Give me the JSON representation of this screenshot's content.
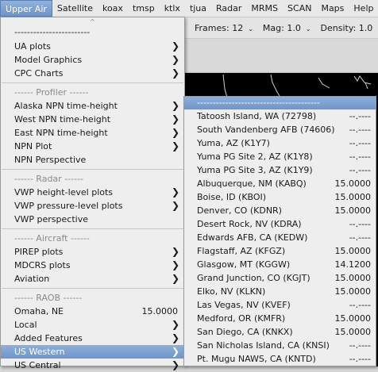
{
  "menubar": [
    "Upper Air",
    "Satellite",
    "koax",
    "tmsp",
    "ktlx",
    "tjua",
    "Radar",
    "MRMS",
    "SCAN",
    "Maps",
    "Help"
  ],
  "toolbar": {
    "frames": "Frames: 12",
    "mag": "Mag: 1.0",
    "density": "Density: 1.0",
    "arrow": "⌄"
  },
  "upper_air_menu": {
    "scroll_up": "^",
    "dashes": "------------------------",
    "ua_plots": "UA plots",
    "model_graphics": "Model Graphics",
    "cpc_charts": "CPC Charts",
    "profiler_header": "------ Profiler ------",
    "alaska_npn": "Alaska NPN time-height",
    "west_npn": "West NPN time-height",
    "east_npn": "East NPN time-height",
    "npn_plot": "NPN Plot",
    "npn_perspective": "NPN Perspective",
    "radar_header": "------ Radar ------",
    "vwp_height": "VWP height-level plots",
    "vwp_pressure": "VWP pressure-level plots",
    "vwp_perspective": "VWP perspective",
    "aircraft_header": "------ Aircraft ------",
    "pirep": "PIREP plots",
    "mdcrs": "MDCRS plots",
    "aviation": "Aviation",
    "raob_header": "------ RAOB ------",
    "omaha": "Omaha, NE",
    "omaha_value": "15.0000",
    "local": "Local",
    "added_features": "Added Features",
    "us_western": "US Western",
    "us_central": "US Central",
    "submenu_arrow": "❯"
  },
  "us_western_menu": {
    "tearoff": "---------------------------------------",
    "stations": [
      {
        "name": "Tatoosh Island, WA (72798)",
        "value": "--.----"
      },
      {
        "name": "South Vandenberg AFB (74606)",
        "value": "--.----"
      },
      {
        "name": "Yuma, AZ (K1Y7)",
        "value": "--.----"
      },
      {
        "name": "Yuma PG Site 2, AZ (K1Y8)",
        "value": "--.----"
      },
      {
        "name": "Yuma PG Site 3, AZ (K1Y9)",
        "value": "--.----"
      },
      {
        "name": "Albuquerque, NM (KABQ)",
        "value": "15.0000"
      },
      {
        "name": "Boise, ID (KBOI)",
        "value": "15.0000"
      },
      {
        "name": "Denver, CO (KDNR)",
        "value": "15.0000"
      },
      {
        "name": "Desert Rock, NV (KDRA)",
        "value": "--.----"
      },
      {
        "name": "Edwards AFB, CA (KEDW)",
        "value": "--.----"
      },
      {
        "name": "Flagstaff, AZ (KFGZ)",
        "value": "15.0000"
      },
      {
        "name": "Glasgow, MT (KGGW)",
        "value": "14.1200"
      },
      {
        "name": "Grand Junction, CO (KGJT)",
        "value": "15.0000"
      },
      {
        "name": "Elko, NV (KLKN)",
        "value": "15.0000"
      },
      {
        "name": "Las Vegas, NV (KVEF)",
        "value": "--.----"
      },
      {
        "name": "Medford, OR (KMFR)",
        "value": "15.0000"
      },
      {
        "name": "San Diego, CA (KNKX)",
        "value": "15.0000"
      },
      {
        "name": "San Nicholas Island, CA (KNSI)",
        "value": "--.----"
      },
      {
        "name": "Pt. Mugu NAWS, CA (KNTD)",
        "value": "--.----"
      }
    ]
  },
  "colors": {
    "selection": "#7aa0cf",
    "menu_bg": "#eeeeee",
    "map_bg": "#000000"
  }
}
